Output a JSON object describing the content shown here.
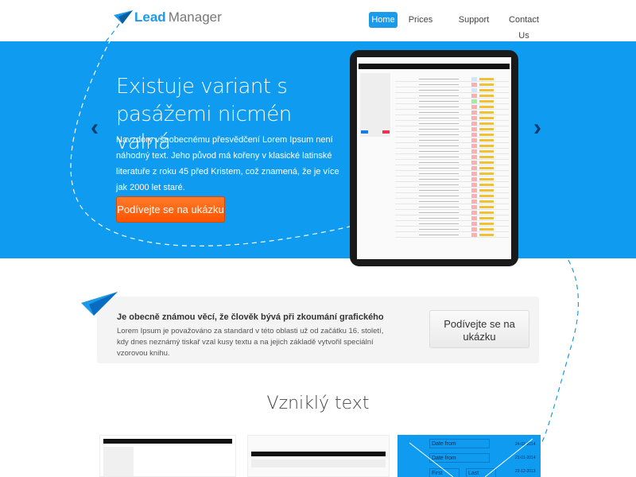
{
  "header": {
    "logo_part1": "Lead",
    "logo_part2": "Manager",
    "nav": [
      {
        "label": "Home",
        "active": true
      },
      {
        "label": "Prices"
      },
      {
        "label": "Support"
      },
      {
        "label": "Contact Us"
      }
    ]
  },
  "hero": {
    "title": "Existuje variant s pasážemi nicmén valná",
    "text": "Navzdory všeobecnému přesvědčení Lorem Ipsum není náhodný text. Jeho původ má kořeny v klasické latinské literatuře z roku 45 před Kristem, což znamená, že je více jak 2000 let staré.",
    "cta": "Podívejte se na ukázku",
    "prev_icon": "chevron-left-icon",
    "next_icon": "chevron-right-icon"
  },
  "callout": {
    "title": "Je obecně známou věcí, že člověk bývá při zkoumání grafického",
    "text": "Lorem Ipsum je považováno za standard v této oblasti už od začátku 16. století, kdy dnes neznámý tiskař vzal kusy textu a na jejich základě vytvořil speciální vzorovou knihu.",
    "button": "Podívejte se na ukázku"
  },
  "section": {
    "title": "Vzniklý text"
  },
  "thumbs": {
    "third": {
      "date_from_1": "Date from",
      "date_from_2": "Date from",
      "first_name": "First name",
      "last_name": "Last name",
      "dates": [
        "24-02-2014",
        "21-01-2014",
        "22-12-2013"
      ]
    }
  },
  "colors": {
    "brand": "#1a9ae8",
    "hero": "#0e9bf0",
    "cta": "#ff5a00"
  }
}
